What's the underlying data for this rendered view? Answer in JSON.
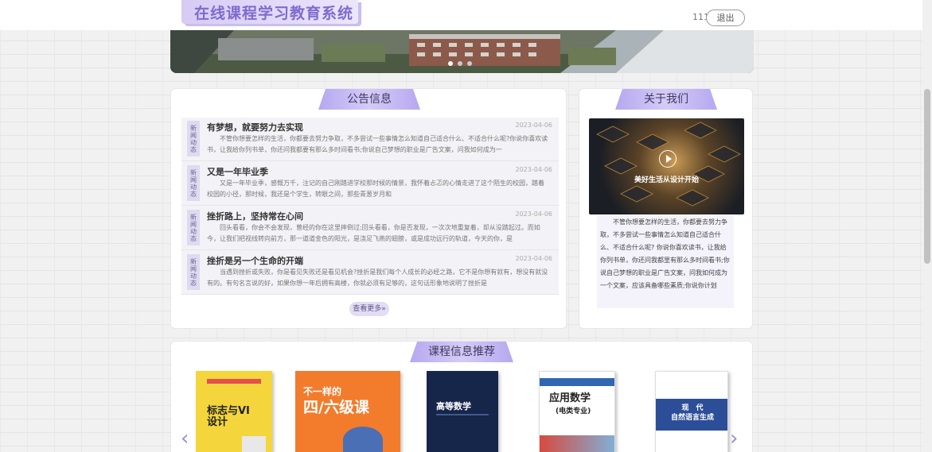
{
  "header": {
    "site_title": "在线课程学习教育系统",
    "username": "111",
    "logout_label": "退出"
  },
  "banner": {
    "dot_count": 3,
    "active_dot": 1
  },
  "notice": {
    "title": "公告信息",
    "tag_text": [
      "新",
      "闻",
      "动",
      "态"
    ],
    "items": [
      {
        "title": "有梦想，就要努力去实现",
        "date": "2023-04-06",
        "excerpt": "不管你想要怎样的生活，你都要去努力争取，不多尝试一些事情怎么知道自己适合什么、不适合什么呢?你说你喜欢读书，让我给你列书单，你还问我都要有那么多时间看书;你说自己梦想的职业是广告文案，问我如何成为一"
      },
      {
        "title": "又是一年毕业季",
        "date": "2023-04-06",
        "excerpt": "又是一年毕业季，感慨万千，注记的自己刚踏进学校那时候的情景，我怀着忐忑的心情走进了这个陌生的校园，踏着校园的小径，那时候，我还是个学生，转眼之间，那些青葱岁月和"
      },
      {
        "title": "挫折路上，坚持常在心间",
        "date": "2023-04-06",
        "excerpt": "回头看看，你会不会发现，曾经的你在这里摔倒过;回头看看，你是否发现，一次次地重复着，却从没踏起过。而如今，让我们把视线转向前方，那一道道金色的阳光，是浇足飞燕的翅膀，或是成功远行的轨道，今天的你，是"
      },
      {
        "title": "挫折是另一个生命的开端",
        "date": "2023-04-06",
        "excerpt": "当遇到挫折或失败，你是看见失败还是看见机会?挫折是我们每个人成长的必经之路，它不是你想有就有，想没有就没有的。有句名言说的好，如果你想一年后拥有高楼，你就必须有足够的，这句话形象地说明了挫折是"
      }
    ],
    "more_label": "查看更多»"
  },
  "about": {
    "title": "关于我们",
    "image_caption": "美好生活从设计开始",
    "text": "不管你想要怎样的生活，你都要去努力争取，不多尝试一些事情怎么知道自己适合什么、不适合什么呢? 你说你喜欢读书，让我给你列书单，你还问我都里有那么多时间看书;你说自己梦想的职业是广告文案，问我如何成为一个文案，应该具备哪些素质;你说你计划"
  },
  "courses": {
    "title": "课程信息推荐",
    "prev_label": "‹",
    "next_label": "›",
    "books": [
      {
        "title_lines": [
          "标志与VI",
          "设计"
        ],
        "bg": "#f4d63c",
        "fg": "#222"
      },
      {
        "title_lines": [
          "不一样的",
          "四/六级课"
        ],
        "bg": "#f37b2c",
        "fg": "#ffffff"
      },
      {
        "title_lines": [
          "高等数学"
        ],
        "bg": "#16254a",
        "fg": "#ffffff"
      },
      {
        "title_lines": [
          "应用数学",
          "(电类专业)"
        ],
        "bg": "#ffffff",
        "fg": "#222"
      },
      {
        "title_lines": [
          "现　代",
          "自然语言生成"
        ],
        "bg": "#ffffff",
        "fg": "#ffffff"
      }
    ]
  },
  "colors": {
    "accent": "#b6a8ef",
    "title_color": "#7e6bd0"
  }
}
